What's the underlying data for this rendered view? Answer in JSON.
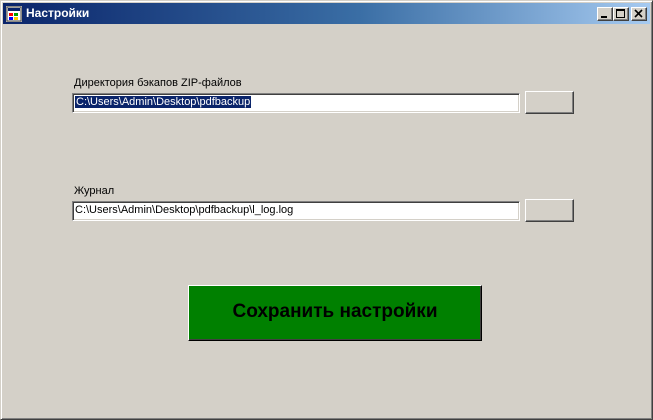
{
  "window": {
    "title": "Настройки",
    "icon": "app-window-icon"
  },
  "caption_buttons": {
    "minimize_icon": "minimize-icon",
    "maximize_icon": "maximize-icon",
    "close_icon": "close-icon"
  },
  "zip_dir": {
    "label": "Директория бэкапов ZIP-файлов",
    "value": "C:\\Users\\Admin\\Desktop\\pdfbackup",
    "browse_label": ""
  },
  "log": {
    "label": "Журнал",
    "value": "C:\\Users\\Admin\\Desktop\\pdfbackup\\l_log.log",
    "browse_label": ""
  },
  "save_button": {
    "label": "Сохранить настройки",
    "color": "#008000"
  },
  "colors": {
    "window_bg": "#d4d0c8",
    "title_gradient_start": "#0a246a",
    "title_gradient_end": "#a6caf0",
    "selection": "#0a246a"
  }
}
